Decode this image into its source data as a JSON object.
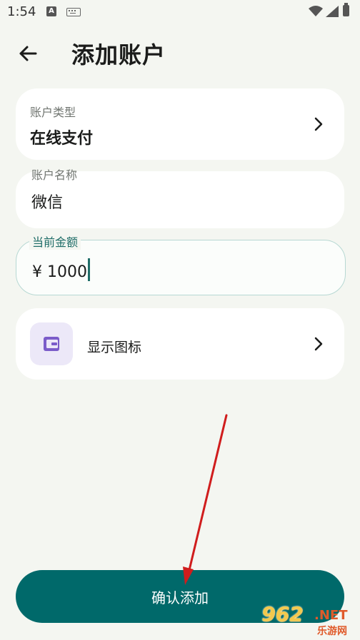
{
  "status_bar": {
    "time": "1:54",
    "a_badge": "A"
  },
  "header": {
    "title": "添加账户"
  },
  "account_type": {
    "label": "账户类型",
    "value": "在线支付"
  },
  "account_name": {
    "label": "账户名称",
    "value": "微信"
  },
  "amount": {
    "label": "当前金额",
    "value": "¥ 1000"
  },
  "icon_row": {
    "label": "显示图标",
    "icon": "wallet-icon",
    "icon_color": "#7b5cc9",
    "icon_bg": "#ece8f8"
  },
  "confirm": {
    "label": "确认添加",
    "color": "#00696a"
  },
  "annotation": {
    "arrow_color": "#d01d1d"
  },
  "watermark": {
    "number": "962",
    "suffix": ".NET",
    "site": "乐游网"
  }
}
